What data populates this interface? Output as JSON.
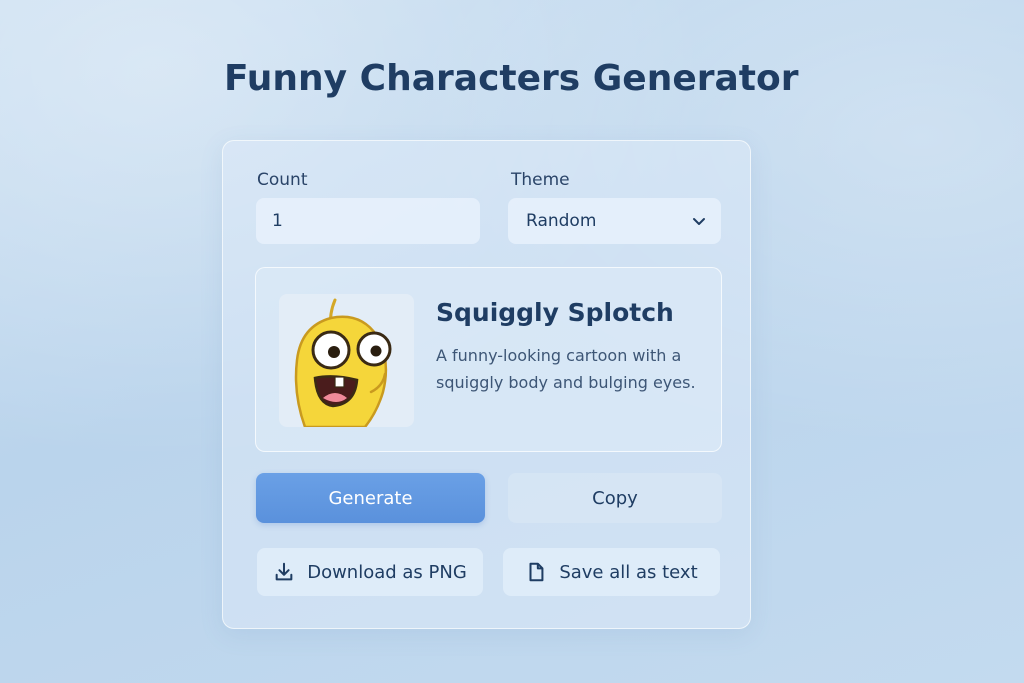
{
  "header": {
    "title": "Funny Characters Generator"
  },
  "form": {
    "count_label": "Count",
    "count_value": "1",
    "theme_label": "Theme",
    "theme_value": "Random"
  },
  "character": {
    "name": "Squiggly Splotch",
    "description": "A funny-looking cartoon with a squiggly body and bulging eyes."
  },
  "actions": {
    "generate_label": "Generate",
    "copy_label": "Copy",
    "download_label": "Download as PNG",
    "save_label": "Save all as text"
  },
  "colors": {
    "primary": "#5a91dc",
    "title": "#1f3d63",
    "character_body": "#f5d63a"
  },
  "icons": {
    "theme_dropdown": "chevron-down-icon",
    "download": "download-icon",
    "save": "file-icon"
  }
}
